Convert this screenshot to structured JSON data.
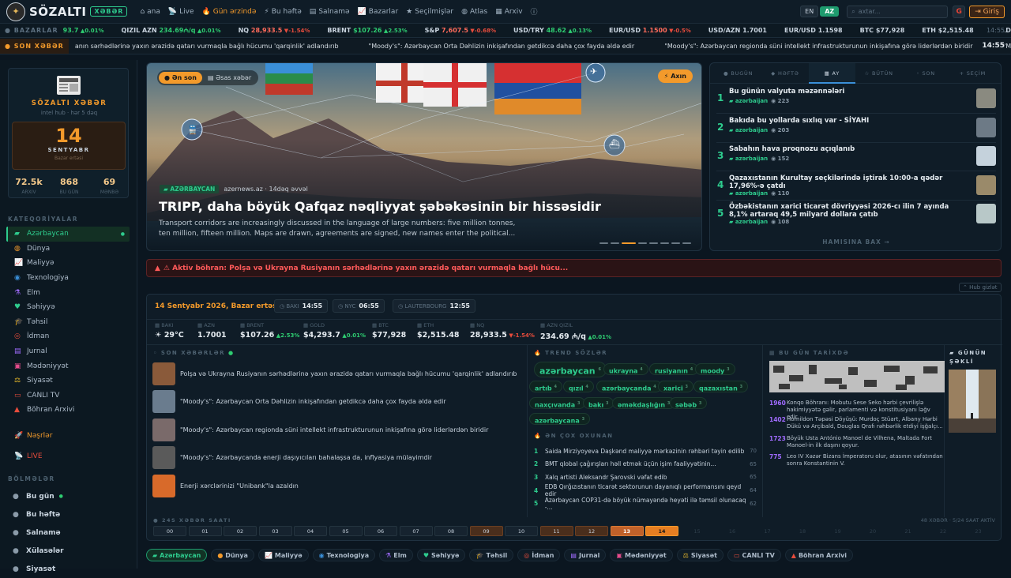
{
  "header": {
    "brand": "SÖZALTI",
    "brand_badge": "XƏBƏR",
    "nav": [
      {
        "icon": "home-icon",
        "glyph": "⌂",
        "label": "ana"
      },
      {
        "icon": "live-icon",
        "glyph": "📡",
        "label": "Live"
      },
      {
        "icon": "fire-icon",
        "glyph": "🔥",
        "label": "Gün ərzində"
      },
      {
        "icon": "bolt-icon",
        "glyph": "⚡",
        "label": "Bu həftə"
      },
      {
        "icon": "newspaper-icon",
        "glyph": "▤",
        "label": "Salnamə"
      },
      {
        "icon": "chart-icon",
        "glyph": "📈",
        "label": "Bazarlar"
      },
      {
        "icon": "star-icon",
        "glyph": "★",
        "label": "Seçilmişlər"
      },
      {
        "icon": "globe-icon",
        "glyph": "◍",
        "label": "Atlas"
      },
      {
        "icon": "archive-icon",
        "glyph": "▦",
        "label": "Arxiv"
      },
      {
        "icon": "info-icon",
        "glyph": "ⓘ",
        "label": ""
      }
    ],
    "lang_en": "EN",
    "lang_az": "AZ",
    "search_placeholder": "axtar...",
    "login": "Giriş"
  },
  "markets": {
    "label": "BAZARLAR",
    "items": [
      {
        "name": "",
        "value": "93.7",
        "dir": "up",
        "pct": "0.01%"
      },
      {
        "name": "QIZIL AZN",
        "value": "234.69₼/q",
        "dir": "up",
        "pct": "0.01%"
      },
      {
        "name": "NQ",
        "value": "28,933.5",
        "dir": "dn",
        "pct": "-1.54%"
      },
      {
        "name": "BRENT",
        "value": "$107.26",
        "dir": "up",
        "pct": "2.53%"
      },
      {
        "name": "S&P",
        "value": "7,607.5",
        "dir": "dn",
        "pct": "-0.68%"
      },
      {
        "name": "USD/TRY",
        "value": "48.62",
        "dir": "up",
        "pct": "0.13%"
      },
      {
        "name": "EUR/USD",
        "value": "1.1500",
        "dir": "dn",
        "pct": "-0.5%"
      },
      {
        "name": "USD/AZN",
        "value": "1.7001",
        "dir": "",
        "pct": ""
      },
      {
        "name": "EUR/USD",
        "value": "1.1598",
        "dir": "",
        "pct": ""
      },
      {
        "name": "BTC",
        "value": "$77,928",
        "dir": "",
        "pct": ""
      },
      {
        "name": "ETH",
        "value": "$2,515.48",
        "dir": "",
        "pct": ""
      },
      {
        "name": "GOLD",
        "value": "$4,293.7",
        "dir": "up",
        "pct": "0.01%"
      }
    ],
    "time": "14:55"
  },
  "news_ticker": {
    "label": "SON XƏBƏR",
    "items": [
      "anın sərhədlərinə yaxın ərazidə qatarı vurmaqla bağlı hücumu 'qarqinlik' adlandırıb",
      "\"Moody's\": Azərbaycan Orta Dəhlizin inkişafından getdikcə daha çox fayda əldə edir",
      "\"Moody's\": Azərbaycan regionda süni intellekt infrastrukturunun inkişafına görə liderlərdən biridir",
      "\"Moody's\": Azərbayc"
    ],
    "time": "14:55"
  },
  "sidebar": {
    "card_title": "SÖZALTI XƏBƏR",
    "card_sub": "intel hub · hər 5 dəq",
    "day": "14",
    "month": "SENTYABR",
    "weekday": "Bazar ertəsi",
    "stats": [
      {
        "value": "72.5k",
        "label": "ARXIV"
      },
      {
        "value": "868",
        "label": "BU GÜN"
      },
      {
        "value": "69",
        "label": "MƏNBƏ"
      }
    ],
    "categories_title": "KATEQORİYALAR",
    "categories": [
      {
        "icon": "flag-icon",
        "glyph": "▰",
        "color": "#2ecc8e",
        "label": "Azərbaycan"
      },
      {
        "icon": "globe-icon",
        "glyph": "◍",
        "color": "#f39a2b",
        "label": "Dünya"
      },
      {
        "icon": "chart-icon",
        "glyph": "📈",
        "color": "#2ecc71",
        "label": "Maliyyə"
      },
      {
        "icon": "chip-icon",
        "glyph": "◉",
        "color": "#3a8fd8",
        "label": "Texnologiya"
      },
      {
        "icon": "flask-icon",
        "glyph": "⚗",
        "color": "#a06bff",
        "label": "Elm"
      },
      {
        "icon": "heart-icon",
        "glyph": "♥",
        "color": "#2ecc8e",
        "label": "Səhiyyə"
      },
      {
        "icon": "grad-icon",
        "glyph": "🎓",
        "color": "#6a7cff",
        "label": "Təhsil"
      },
      {
        "icon": "target-icon",
        "glyph": "◎",
        "color": "#e74c3c",
        "label": "İdman"
      },
      {
        "icon": "book-icon",
        "glyph": "▤",
        "color": "#a06bff",
        "label": "Jurnal"
      },
      {
        "icon": "culture-icon",
        "glyph": "▣",
        "color": "#e74c8c",
        "label": "Mədəniyyət"
      },
      {
        "icon": "politics-icon",
        "glyph": "⚖",
        "color": "#f3c12b",
        "label": "Siyasət"
      },
      {
        "icon": "tv-icon",
        "glyph": "▭",
        "color": "#e74c3c",
        "label": "CANLI TV"
      },
      {
        "icon": "warning-icon",
        "glyph": "▲",
        "color": "#e74c3c",
        "label": "Böhran Arxivi"
      }
    ],
    "extra": [
      {
        "icon": "rocket-icon",
        "glyph": "🚀",
        "color": "#f39a2b",
        "label": "Nəşrlər"
      },
      {
        "icon": "live-icon",
        "glyph": "📡",
        "color": "#e74c3c",
        "label": "LIVE"
      }
    ],
    "sections_title": "BÖLMƏLƏR",
    "sections": [
      {
        "icon": "dot-icon",
        "glyph": "●",
        "label": "Bu gün"
      },
      {
        "icon": "dot-icon",
        "glyph": "●",
        "label": "Bu həftə"
      },
      {
        "icon": "dot-icon",
        "glyph": "●",
        "label": "Salnamə"
      },
      {
        "icon": "dot-icon",
        "glyph": "●",
        "label": "Xülasələr"
      },
      {
        "icon": "dot-icon",
        "glyph": "●",
        "label": "Siyasət"
      }
    ]
  },
  "hero": {
    "tab_latest": "Ən son",
    "tab_main": "Əsas xəbər",
    "axin": "Axın",
    "category": "AZƏRBAYCAN",
    "source": "azernews.az · 14dəq əvvəl",
    "title": "TRIPP, daha böyük Qafqaz nəqliyyat şəbəkəsinin bir hissəsidir",
    "desc": "Transport corridors are increasingly discussed in the language of large numbers: five million tonnes, ten million, fifteen million. Maps are drawn, agreements are signed, new names enter the political..."
  },
  "top": {
    "tabs": [
      "BUGÜN",
      "HƏFTƏ",
      "AY",
      "BÜTÜN",
      "SON",
      "SEÇİM"
    ],
    "items": [
      {
        "title": "Bu günün valyuta məzənnələri",
        "cat": "azərbaijan",
        "views": "223"
      },
      {
        "title": "Bakıda bu yollarda sıxlıq var - SİYAHI",
        "cat": "azərbaijan",
        "views": "203"
      },
      {
        "title": "Sabahın hava proqnozu açıqlanıb",
        "cat": "azərbaijan",
        "views": "152"
      },
      {
        "title": "Qazaxıstanın Kurultay seçkilərində iştirak 10:00-a qədər 17,96%-ə çatdı",
        "cat": "azərbaijan",
        "views": "110"
      },
      {
        "title": "Özbəkistanın xarici ticarət dövriyyəsi 2026-cı ilin 7 ayında 8,1% artaraq 49,5 milyard dollara çatıb",
        "cat": "azərbaijan",
        "views": "108"
      }
    ],
    "more": "HAMISINA BAX →"
  },
  "alert": "⚠ Aktiv böhran: Polşa və Ukrayna Rusiyanın sərhədlərinə yaxın ərazidə qatarı vurmaqla bağlı hücu...",
  "hub_toggle": "Hub gizlət",
  "hub": {
    "date": "14 Sentyabr 2026, Bazar ertəsi",
    "clocks": [
      {
        "city": "BAKI",
        "time": "14:55"
      },
      {
        "city": "NYC",
        "time": "06:55"
      },
      {
        "city": "LAUTERBOURG",
        "time": "12:55"
      }
    ],
    "strip": [
      {
        "label": "BAKI",
        "value": "☀ 29°C",
        "pct": "",
        "dir": ""
      },
      {
        "label": "AZN",
        "value": "1.7001",
        "pct": "",
        "dir": ""
      },
      {
        "label": "BRENT",
        "value": "$107.26",
        "pct": "2.53%",
        "dir": "up"
      },
      {
        "label": "GOLD",
        "value": "$4,293.7",
        "pct": "0.01%",
        "dir": "up"
      },
      {
        "label": "BTC",
        "value": "$77,928",
        "pct": "",
        "dir": ""
      },
      {
        "label": "ETH",
        "value": "$2,515.48",
        "pct": "",
        "dir": ""
      },
      {
        "label": "NQ",
        "value": "28,933.5",
        "pct": "-1.54%",
        "dir": "dn"
      },
      {
        "label": "AZN QIZIL",
        "value": "234.69 ₼/q",
        "pct": "0.01%",
        "dir": "up"
      }
    ],
    "news_title": "SON XƏBƏRLƏR",
    "news": [
      "Polşa və Ukrayna Rusiyanın sərhədlərinə yaxın ərazidə qatarı vurmaqla bağlı hücumu 'qarqinlik' adlandırıb",
      "\"Moody's\": Azərbaycan Orta Dəhlizin inkişafından getdikcə daha çox fayda əldə edir",
      "\"Moody's\": Azərbaycan regionda süni intellekt infrastrukturunun inkişafına görə liderlərdən biridir",
      "\"Moody's\": Azərbaycanda enerji daşıyıcıları bahalaşsa da, inflyasiya mülayimdir",
      "Enerji xərclərinizi \"Unibank\"la azaldın"
    ],
    "trend_title": "TREND SÖZLƏR",
    "tags": [
      {
        "t": "azərbaycan",
        "n": "6"
      },
      {
        "t": "ukrayna",
        "n": "4"
      },
      {
        "t": "rusiyanın",
        "n": "4"
      },
      {
        "t": "moody",
        "n": "3"
      },
      {
        "t": "artıb",
        "n": "4"
      },
      {
        "t": "qızıl",
        "n": "4"
      },
      {
        "t": "azərbaycanda",
        "n": "4"
      },
      {
        "t": "xarici",
        "n": "3"
      },
      {
        "t": "qazaxıstan",
        "n": "3"
      },
      {
        "t": "naxçıvanda",
        "n": "3"
      },
      {
        "t": "bakı",
        "n": "3"
      },
      {
        "t": "əməkdaşlığın",
        "n": "3"
      },
      {
        "t": "səbəb",
        "n": "3"
      },
      {
        "t": "azərbaycana",
        "n": "3"
      }
    ],
    "most_title": "ƏN ÇOX OXUNAN",
    "most": [
      {
        "t": "Saida Mirziyoyeva Daşkənd maliyyə mərkəzinin rəhbəri təyin edilib",
        "s": "70"
      },
      {
        "t": "BMT qlobal çağırışları həll etmək üçün işim faaliyyətinin...",
        "s": "65"
      },
      {
        "t": "Xalq artisti Aleksandr Şarovski vəfat edib",
        "s": "65"
      },
      {
        "t": "EDB Qırğızıstanın ticarət sektorunun dayanıqlı performansını qeyd edir",
        "s": "64"
      },
      {
        "t": "Azərbaycan COP31-də böyük nümayəndə heyəti ilə təmsil olunacaq -...",
        "s": "62"
      }
    ],
    "hist_title": "BU GÜN TARİXDƏ",
    "hist": [
      {
        "y": "1960",
        "t": "Konqo Böhranı: Mobutu Sese Seko hərbi çevrilişlə hakimiyyətə gəlir, parlamenti və konstitusiyanı ləğv edir."
      },
      {
        "y": "1402",
        "t": "Homildon Təpəsi Döyüşü: Murdoç Stüart, Albany Hərbi Dükü və Arçibald, Douglas Qrafı rəhbərlik etdiyi işğalçı..."
      },
      {
        "y": "1723",
        "t": "Böyük Usta António Manoel de Vilhena, Maltada Fort Manoel-in ilk daşını qoyur."
      },
      {
        "y": "775",
        "t": "Leo IV Xəzər Bizans İmperatoru olur, atasının vəfatından sonra Konstantinin V."
      }
    ],
    "photo_title": "GÜNÜN ŞƏKLİ",
    "hours_title": "24S XƏBƏR SAATI",
    "hours_note": "48 XƏBƏR · 5/24 SAAT AKTİV",
    "hours": [
      {
        "h": "00",
        "lvl": 0
      },
      {
        "h": "01",
        "lvl": 0
      },
      {
        "h": "02",
        "lvl": 0
      },
      {
        "h": "03",
        "lvl": 0
      },
      {
        "h": "04",
        "lvl": 0
      },
      {
        "h": "05",
        "lvl": 0
      },
      {
        "h": "06",
        "lvl": 0
      },
      {
        "h": "07",
        "lvl": 0
      },
      {
        "h": "08",
        "lvl": 0
      },
      {
        "h": "09",
        "lvl": 1
      },
      {
        "h": "10",
        "lvl": 0
      },
      {
        "h": "11",
        "lvl": 1
      },
      {
        "h": "12",
        "lvl": 1
      },
      {
        "h": "13",
        "lvl": 2
      },
      {
        "h": "14",
        "lvl": 3
      },
      {
        "h": "15",
        "lvl": -1
      },
      {
        "h": "16",
        "lvl": -1
      },
      {
        "h": "17",
        "lvl": -1
      },
      {
        "h": "18",
        "lvl": -1
      },
      {
        "h": "19",
        "lvl": -1
      },
      {
        "h": "20",
        "lvl": -1
      },
      {
        "h": "21",
        "lvl": -1
      },
      {
        "h": "22",
        "lvl": -1
      },
      {
        "h": "23",
        "lvl": -1
      }
    ]
  },
  "chips": [
    {
      "icon": "flag-icon",
      "glyph": "▰",
      "label": "Azərbaycan"
    },
    {
      "icon": "globe-icon",
      "glyph": "●",
      "label": "Dünya"
    },
    {
      "icon": "chart-icon",
      "glyph": "📈",
      "label": "Maliyyə"
    },
    {
      "icon": "chip-icon",
      "glyph": "◉",
      "label": "Texnologiya"
    },
    {
      "icon": "flask-icon",
      "glyph": "⚗",
      "label": "Elm"
    },
    {
      "icon": "heart-icon",
      "glyph": "♥",
      "label": "Səhiyyə"
    },
    {
      "icon": "grad-icon",
      "glyph": "🎓",
      "label": "Təhsil"
    },
    {
      "icon": "target-icon",
      "glyph": "◎",
      "label": "İdman"
    },
    {
      "icon": "book-icon",
      "glyph": "▤",
      "label": "Jurnal"
    },
    {
      "icon": "culture-icon",
      "glyph": "▣",
      "label": "Mədəniyyət"
    },
    {
      "icon": "politics-icon",
      "glyph": "⚖",
      "label": "Siyasət"
    },
    {
      "icon": "tv-icon",
      "glyph": "▭",
      "label": "CANLI TV"
    },
    {
      "icon": "warning-icon",
      "glyph": "▲",
      "label": "Böhran Arxivi"
    }
  ],
  "colors": {
    "accent": "#f39a2b",
    "green": "#2ecc8e",
    "alert": "#ff5a5a",
    "bg": "#0b1620"
  }
}
